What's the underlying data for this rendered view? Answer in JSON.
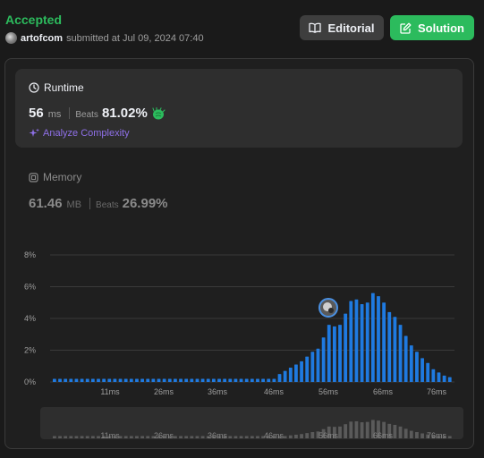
{
  "header": {
    "status": "Accepted",
    "username": "artofcom",
    "submitted_text": "submitted at Jul 09, 2024 07:40"
  },
  "buttons": {
    "editorial": "Editorial",
    "solution": "Solution"
  },
  "runtime": {
    "label": "Runtime",
    "value": "56",
    "unit": "ms",
    "beats_label": "Beats",
    "beats_value": "81.02%",
    "analyze_label": "Analyze Complexity"
  },
  "memory": {
    "label": "Memory",
    "value": "61.46",
    "unit": "MB",
    "beats_label": "Beats",
    "beats_value": "26.99%"
  },
  "colors": {
    "accepted": "#2cbb5d",
    "bar": "#1f7ae0",
    "analyze": "#8f70e8"
  },
  "chart_data": {
    "type": "bar",
    "ylabel": "",
    "xlabel": "",
    "y_ticks": [
      "0%",
      "2%",
      "4%",
      "6%",
      "8%"
    ],
    "ylim": [
      0,
      8
    ],
    "x_ticks": [
      "11ms",
      "26ms",
      "36ms",
      "46ms",
      "56ms",
      "66ms",
      "76ms"
    ],
    "values": [
      0.2,
      0.2,
      0.2,
      0.2,
      0.2,
      0.2,
      0.2,
      0.2,
      0.2,
      0.2,
      0.2,
      0.2,
      0.2,
      0.2,
      0.2,
      0.2,
      0.2,
      0.2,
      0.2,
      0.2,
      0.2,
      0.2,
      0.2,
      0.2,
      0.2,
      0.2,
      0.2,
      0.2,
      0.2,
      0.2,
      0.2,
      0.2,
      0.2,
      0.2,
      0.2,
      0.2,
      0.2,
      0.2,
      0.2,
      0.2,
      0.2,
      0.5,
      0.7,
      0.9,
      1.1,
      1.3,
      1.6,
      1.9,
      2.1,
      2.8,
      3.6,
      3.5,
      3.6,
      4.3,
      5.1,
      5.2,
      4.9,
      5.0,
      5.6,
      5.4,
      5.0,
      4.4,
      4.1,
      3.6,
      2.9,
      2.3,
      1.9,
      1.5,
      1.2,
      0.8,
      0.6,
      0.4,
      0.3
    ],
    "highlight_label": "56ms",
    "grid": true
  }
}
